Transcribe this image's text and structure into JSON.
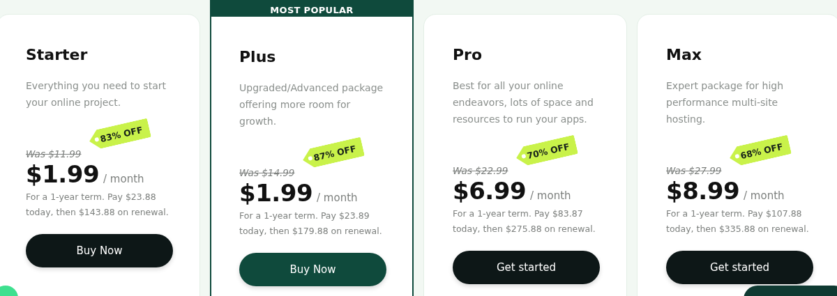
{
  "plans": [
    {
      "name": "Starter",
      "popular": false,
      "description": "Everything you need to start your online project.",
      "was": "Was $11.99",
      "discount": "83% OFF",
      "price": "$1.99",
      "period": "/ month",
      "terms": "For a 1-year term. Pay $23.88 today, then $143.88 on renewal.",
      "button": "Buy Now"
    },
    {
      "name": "Plus",
      "popular": true,
      "banner": "MOST POPULAR",
      "description": "Upgraded/Advanced package offering more room for growth.",
      "was": "Was $14.99",
      "discount": "87% OFF",
      "price": "$1.99",
      "period": "/ month",
      "terms": "For a 1-year term. Pay $23.89 today, then $179.88 on renewal.",
      "button": "Buy Now"
    },
    {
      "name": "Pro",
      "popular": false,
      "description": "Best for all your online endeavors, lots of space and resources to run your apps.",
      "was": "Was $22.99",
      "discount": "70% OFF",
      "price": "$6.99",
      "period": "/ month",
      "terms": "For a 1-year term. Pay $83.87 today, then $275.88 on renewal.",
      "button": "Get started"
    },
    {
      "name": "Max",
      "popular": false,
      "description": "Expert package for high performance multi-site hosting.",
      "was": "Was $27.99",
      "discount": "68% OFF",
      "price": "$8.99",
      "period": "/ month",
      "terms": "For a 1-year term. Pay $107.88 today, then $335.88 on renewal.",
      "button": "Get started"
    }
  ]
}
